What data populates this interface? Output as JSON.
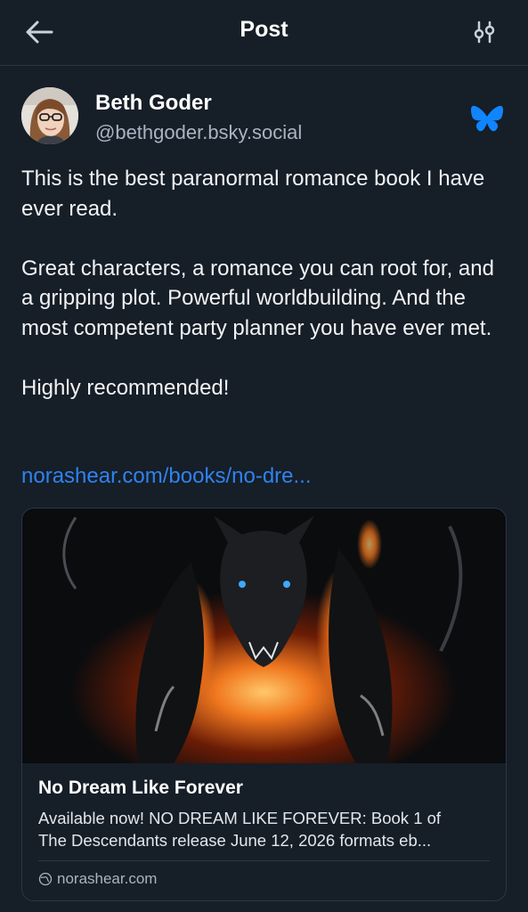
{
  "header": {
    "title": "Post",
    "back_icon": "arrow-left-icon",
    "settings_icon": "sliders-icon"
  },
  "post": {
    "author_name": "Beth Goder",
    "author_handle": "@bethgoder.bsky.social",
    "badge_icon": "butterfly-icon",
    "paragraphs": [
      "This is the best paranormal romance book I have ever read.",
      "Great characters, a romance you can root for, and a gripping plot. Powerful worldbuilding. And the most competent party planner you have ever met.",
      "Highly recommended!"
    ],
    "link_text": "norashear.com/books/no-dre..."
  },
  "card": {
    "title": "No Dream Like Forever",
    "description_line1": "Available now! NO DREAM LIKE FOREVER: Book 1 of",
    "description_line2": "The Descendants release June 12, 2026 formats eb...",
    "domain": "norashear.com",
    "domain_icon": "globe-icon"
  },
  "colors": {
    "background": "#161e27",
    "link": "#2f82f0",
    "bluesky_butterfly": "#1185fe",
    "muted_text": "#a9b4c2"
  }
}
